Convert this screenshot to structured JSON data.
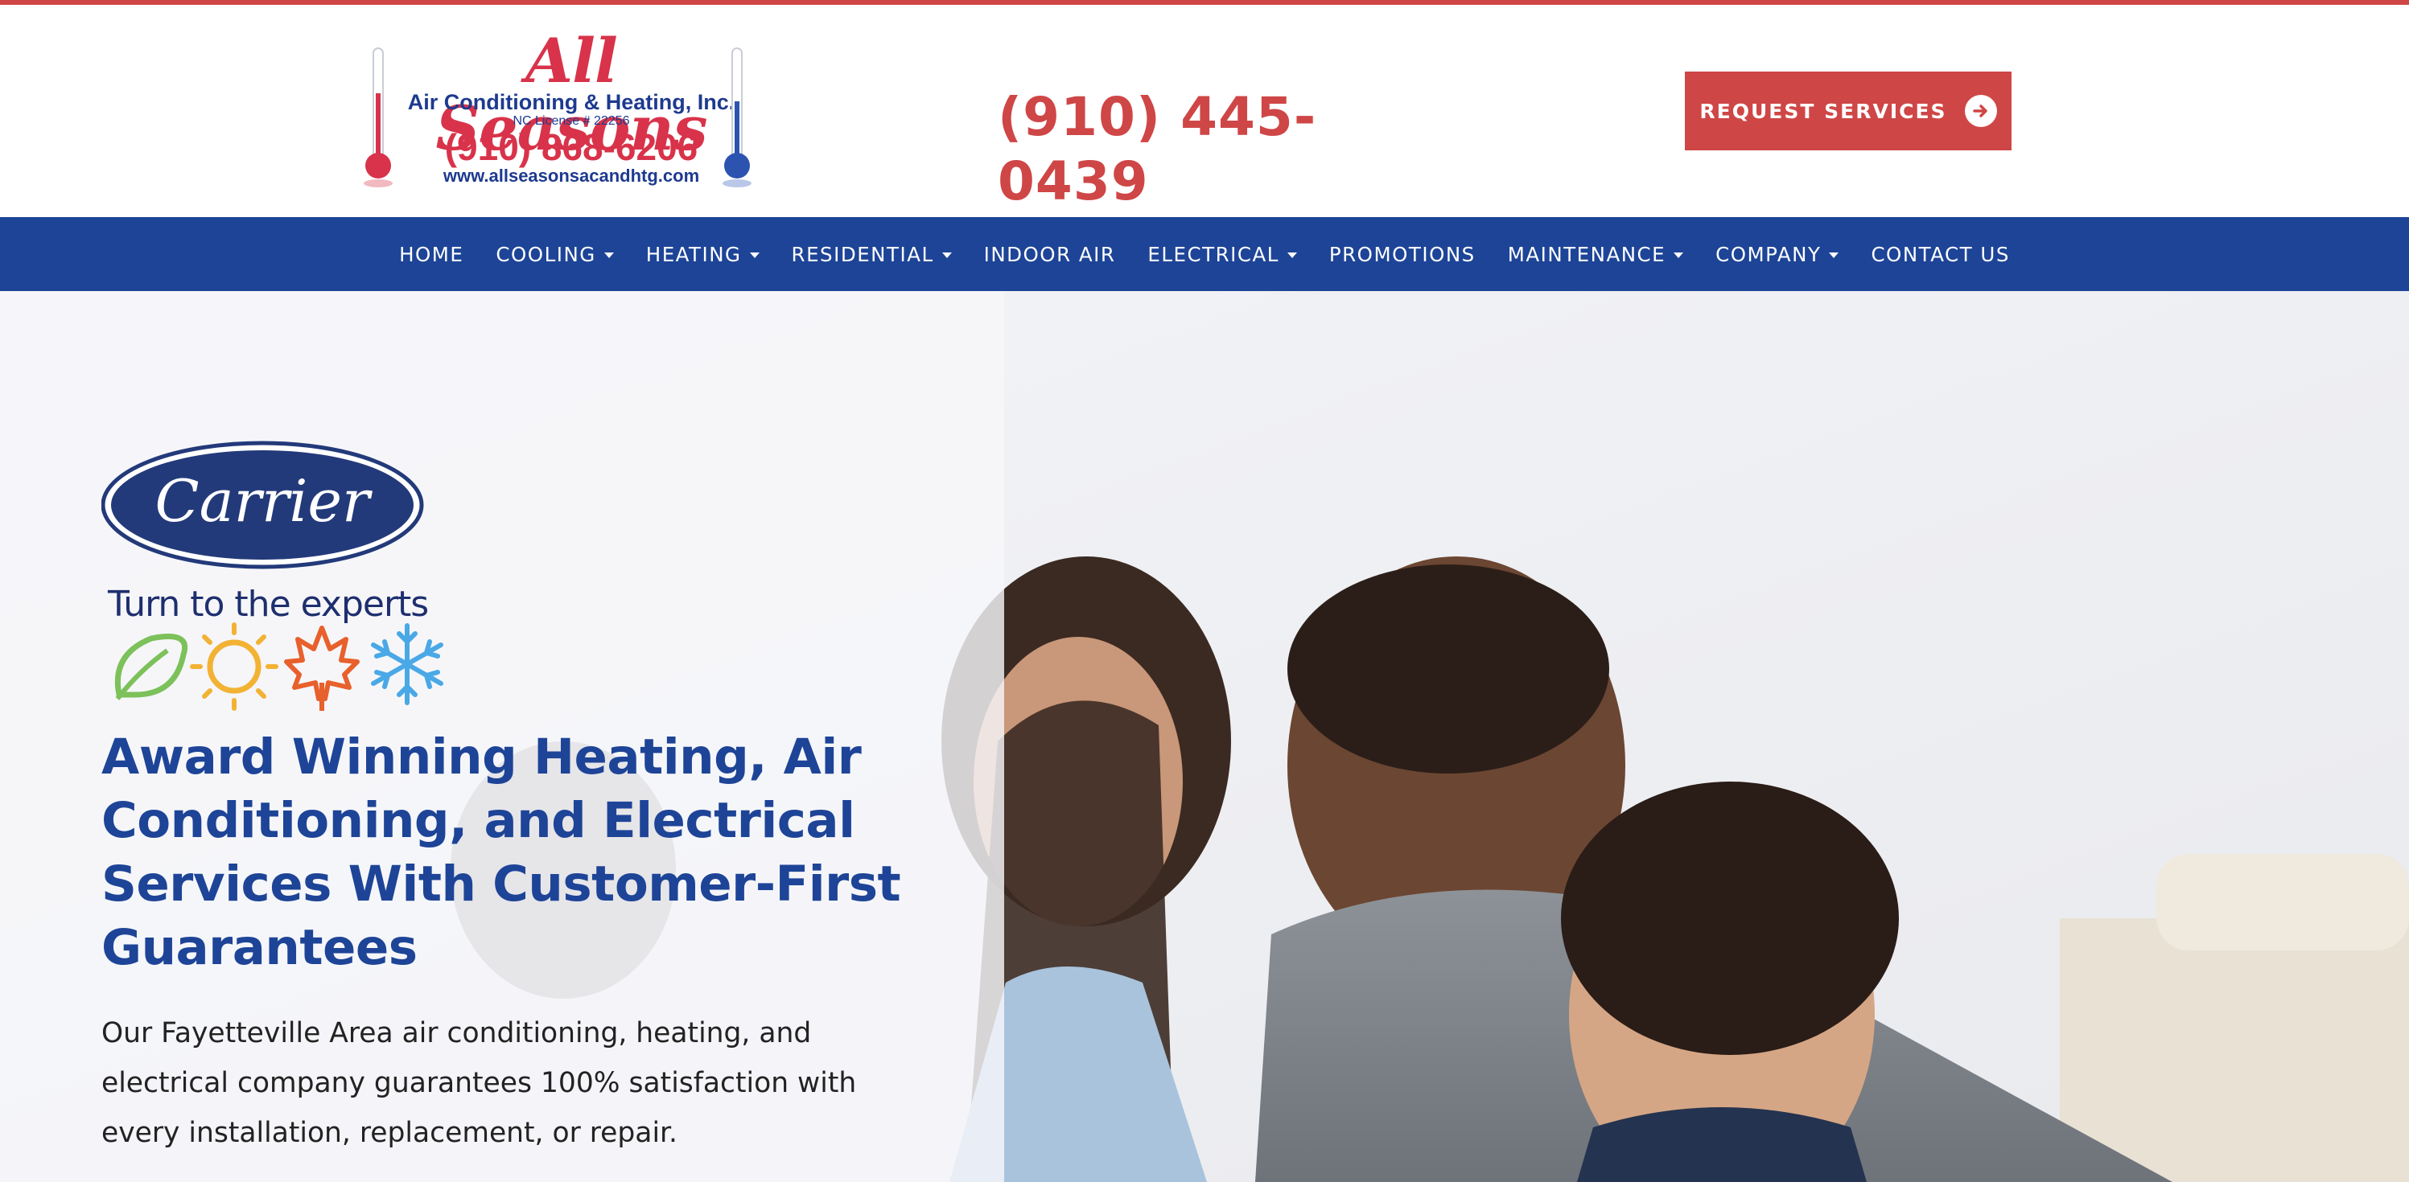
{
  "brand": {
    "name": "All Seasons",
    "subtitle": "Air Conditioning & Heating, Inc.",
    "license": "NC License # 22256",
    "logo_phone": "(910) 868-6206",
    "url": "www.allseasonsacandhtg.com"
  },
  "header": {
    "phone": "(910) 445-0439",
    "cta_label": "REQUEST SERVICES",
    "cta_icon": "arrow-right-circle-icon"
  },
  "nav": {
    "items": [
      {
        "label": "HOME",
        "dropdown": false
      },
      {
        "label": "COOLING",
        "dropdown": true
      },
      {
        "label": "HEATING",
        "dropdown": true
      },
      {
        "label": "RESIDENTIAL",
        "dropdown": true
      },
      {
        "label": "INDOOR AIR",
        "dropdown": false
      },
      {
        "label": "ELECTRICAL",
        "dropdown": true
      },
      {
        "label": "PROMOTIONS",
        "dropdown": false
      },
      {
        "label": "MAINTENANCE",
        "dropdown": true
      },
      {
        "label": "COMPANY",
        "dropdown": true
      },
      {
        "label": "CONTACT US",
        "dropdown": false
      }
    ]
  },
  "hero": {
    "carrier_name": "Carrier",
    "carrier_tagline": "Turn to the experts",
    "season_icons": [
      "leaf-icon",
      "sun-icon",
      "maple-leaf-icon",
      "snowflake-icon"
    ],
    "heading": "Award Winning Heating, Air Conditioning, and Electrical Services With Customer-First Guarantees",
    "body": "Our Fayetteville Area air conditioning, heating, and electrical company guarantees 100% satisfaction with every installation, replacement, or repair."
  },
  "colors": {
    "accent_red": "#cf4646",
    "nav_blue": "#1d4497",
    "carrier_navy": "#233a7a"
  }
}
